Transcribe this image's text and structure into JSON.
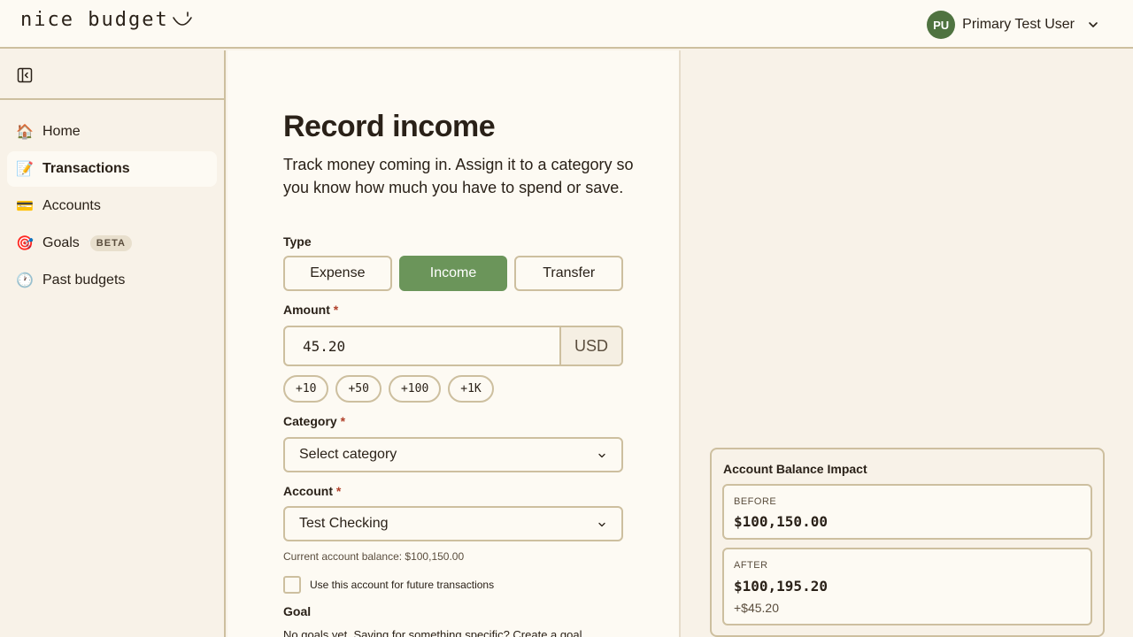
{
  "app": {
    "logo_text": "nice budget",
    "user": {
      "initials": "PU",
      "name": "Primary Test User"
    }
  },
  "sidebar": {
    "items": [
      {
        "label": "Home",
        "icon": "🏠"
      },
      {
        "label": "Transactions",
        "icon": "📝",
        "active": true
      },
      {
        "label": "Accounts",
        "icon": "💳"
      },
      {
        "label": "Goals",
        "icon": "🎯",
        "badge": "BETA"
      },
      {
        "label": "Past budgets",
        "icon": "🕐"
      }
    ]
  },
  "form": {
    "title": "Record income",
    "subtitle": "Track money coming in. Assign it to a category so you know how much you have to spend or save.",
    "type_label": "Type",
    "types": [
      "Expense",
      "Income",
      "Transfer"
    ],
    "active_type": "Income",
    "amount_label": "Amount",
    "amount_value": "45.20",
    "currency": "USD",
    "quick_amounts": [
      "+10",
      "+50",
      "+100",
      "+1K"
    ],
    "category_label": "Category",
    "category_placeholder": "Select category",
    "account_label": "Account",
    "account_value": "Test Checking",
    "account_balance_hint": "Current account balance: $100,150.00",
    "remember_label": "Use this account for future transactions",
    "goal_label": "Goal",
    "goal_text": "No goals yet. Saving for something specific? Create a goal"
  },
  "impact": {
    "title": "Account Balance Impact",
    "before_label": "BEFORE",
    "before_value": "$100,150.00",
    "after_label": "AFTER",
    "after_value": "$100,195.20",
    "after_delta": "+$45.20"
  },
  "colors": {
    "accent_green": "#6b955a",
    "avatar_green": "#4f7340",
    "border_tan": "#cdbf9f",
    "background": "#f8f2e8",
    "surface": "#fdfaf3",
    "required_red": "#b0402a"
  }
}
